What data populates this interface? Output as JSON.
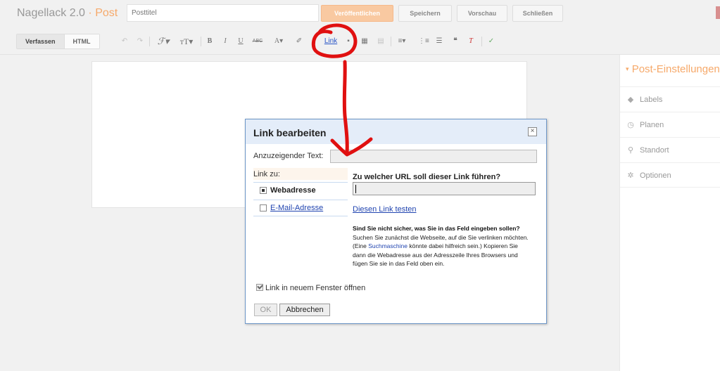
{
  "topbar": {
    "blog_name": "Nagellack 2.0",
    "separator": "·",
    "section": "Post",
    "title_placeholder": "Posttitel",
    "buttons": {
      "publish": "Veröffentlichen",
      "save": "Speichern",
      "preview": "Vorschau",
      "close": "Schließen"
    }
  },
  "toolbar": {
    "tabs": [
      "Verfassen",
      "HTML"
    ],
    "link_label": "Link"
  },
  "sidebar": {
    "heading": "Post-Einstellungen",
    "items": [
      {
        "label": "Labels",
        "icon": "tag-icon"
      },
      {
        "label": "Planen",
        "icon": "clock-icon"
      },
      {
        "label": "Standort",
        "icon": "location-pin-icon"
      },
      {
        "label": "Optionen",
        "icon": "gear-icon"
      }
    ]
  },
  "dialog": {
    "title": "Link bearbeiten",
    "close_symbol": "×",
    "display_text_label": "Anzuzeigender Text:",
    "display_text_value": "",
    "link_to_label": "Link zu:",
    "options": [
      {
        "label": "Webadresse",
        "selected": true
      },
      {
        "label": "E-Mail-Adresse",
        "selected": false
      }
    ],
    "url_question": "Zu welcher URL soll dieser Link führen?",
    "url_value": "",
    "test_link": "Diesen Link testen",
    "help": {
      "bold": "Sind Sie nicht sicher, was Sie in das Feld eingeben sollen?",
      "part1": " Suchen Sie zunächst die Webseite, auf die Sie verlinken möchten. (Eine ",
      "keyword": "Suchmaschine",
      "part2": " könnte dabei hilfreich sein.) Kopieren Sie dann die Webadresse aus der Adresszeile Ihres Browsers und fügen Sie sie in das Feld oben ein."
    },
    "new_window_label": "Link in neuem Fenster öffnen",
    "new_window_checked": true,
    "ok_label": "OK",
    "cancel_label": "Abbrechen"
  },
  "colors": {
    "accent": "#f6a96a",
    "dialog_border": "#6e97c8",
    "dialog_header": "#e4edf9",
    "link_blue": "#2044b0",
    "annotation_red": "#e01010"
  }
}
